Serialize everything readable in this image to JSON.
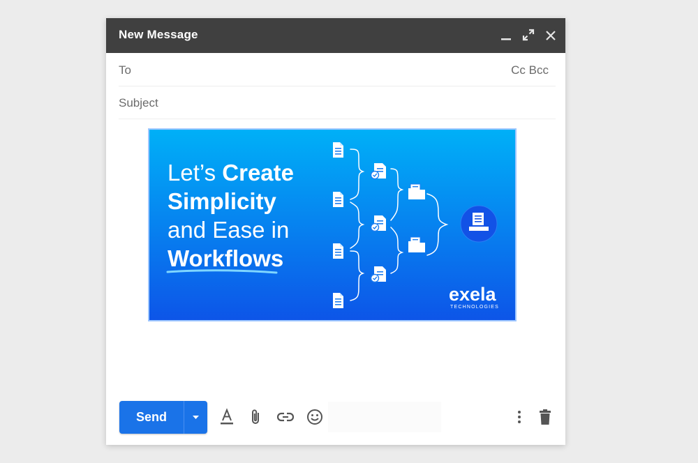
{
  "window": {
    "title": "New Message"
  },
  "icons": {
    "minimize": "minimize-icon",
    "expand": "expand-icon",
    "close": "close-icon",
    "formatting": "text-format-icon",
    "attach": "paperclip-icon",
    "link": "link-icon",
    "emoji": "emoji-icon",
    "more": "more-vert-icon",
    "delete": "trash-icon",
    "send_options": "caret-down-icon"
  },
  "fields": {
    "to": {
      "label": "To",
      "value": ""
    },
    "cc_label": "Cc",
    "bcc_label": "Bcc",
    "subject": {
      "label": "Subject",
      "value": ""
    }
  },
  "body": {
    "banner": {
      "headline_line1_light": "Let’s ",
      "headline_line1_bold": "Create",
      "headline_line2_bold": "Simplicity",
      "headline_line3_light": "and Ease in",
      "headline_line4_bold": "Workflows",
      "logo_text": "exela",
      "logo_subtext": "TECHNOLOGIES",
      "gradient_top": "#00b0f7",
      "gradient_bottom": "#0d55e8"
    }
  },
  "toolbar": {
    "send_label": "Send"
  },
  "colors": {
    "header_bg": "#404040",
    "send_bg": "#1a73e8",
    "page_bg": "#ececec",
    "label_gray": "#6b6b6b"
  }
}
